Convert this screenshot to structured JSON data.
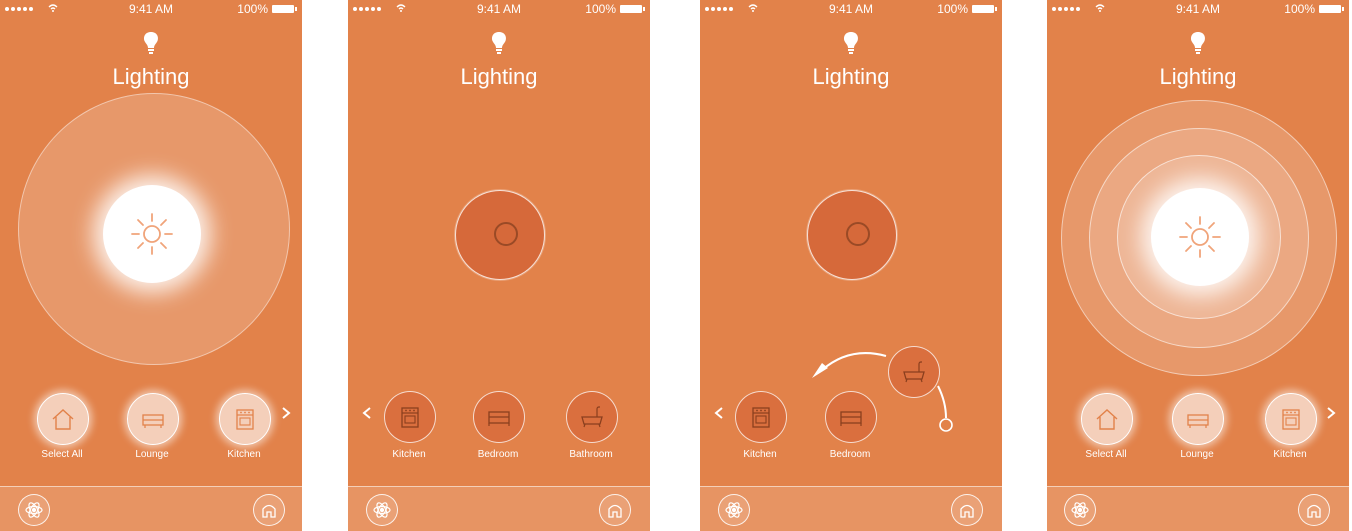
{
  "status_bar": {
    "time": "9:41 AM",
    "battery": "100%"
  },
  "colors": {
    "background": "#e2824a",
    "bottom_bar": "#e79463",
    "accent_white": "#ffffff",
    "knob_dark": "#d6693a"
  },
  "screens": [
    {
      "title": "Lighting",
      "state": "all-on",
      "rooms": [
        {
          "label": "Select All",
          "icon": "house-icon"
        },
        {
          "label": "Lounge",
          "icon": "sofa-icon"
        },
        {
          "label": "Kitchen",
          "icon": "oven-icon"
        }
      ]
    },
    {
      "title": "Lighting",
      "state": "off",
      "rooms": [
        {
          "label": "Kitchen",
          "icon": "oven-icon"
        },
        {
          "label": "Bedroom",
          "icon": "bed-icon"
        },
        {
          "label": "Bathroom",
          "icon": "bathtub-icon"
        }
      ]
    },
    {
      "title": "Lighting",
      "state": "dragging",
      "rooms": [
        {
          "label": "Kitchen",
          "icon": "oven-icon"
        },
        {
          "label": "Bedroom",
          "icon": "bed-icon"
        }
      ]
    },
    {
      "title": "Lighting",
      "state": "bright",
      "rooms": [
        {
          "label": "Select All",
          "icon": "house-icon"
        },
        {
          "label": "Lounge",
          "icon": "sofa-icon"
        },
        {
          "label": "Kitchen",
          "icon": "oven-icon"
        }
      ]
    }
  ]
}
